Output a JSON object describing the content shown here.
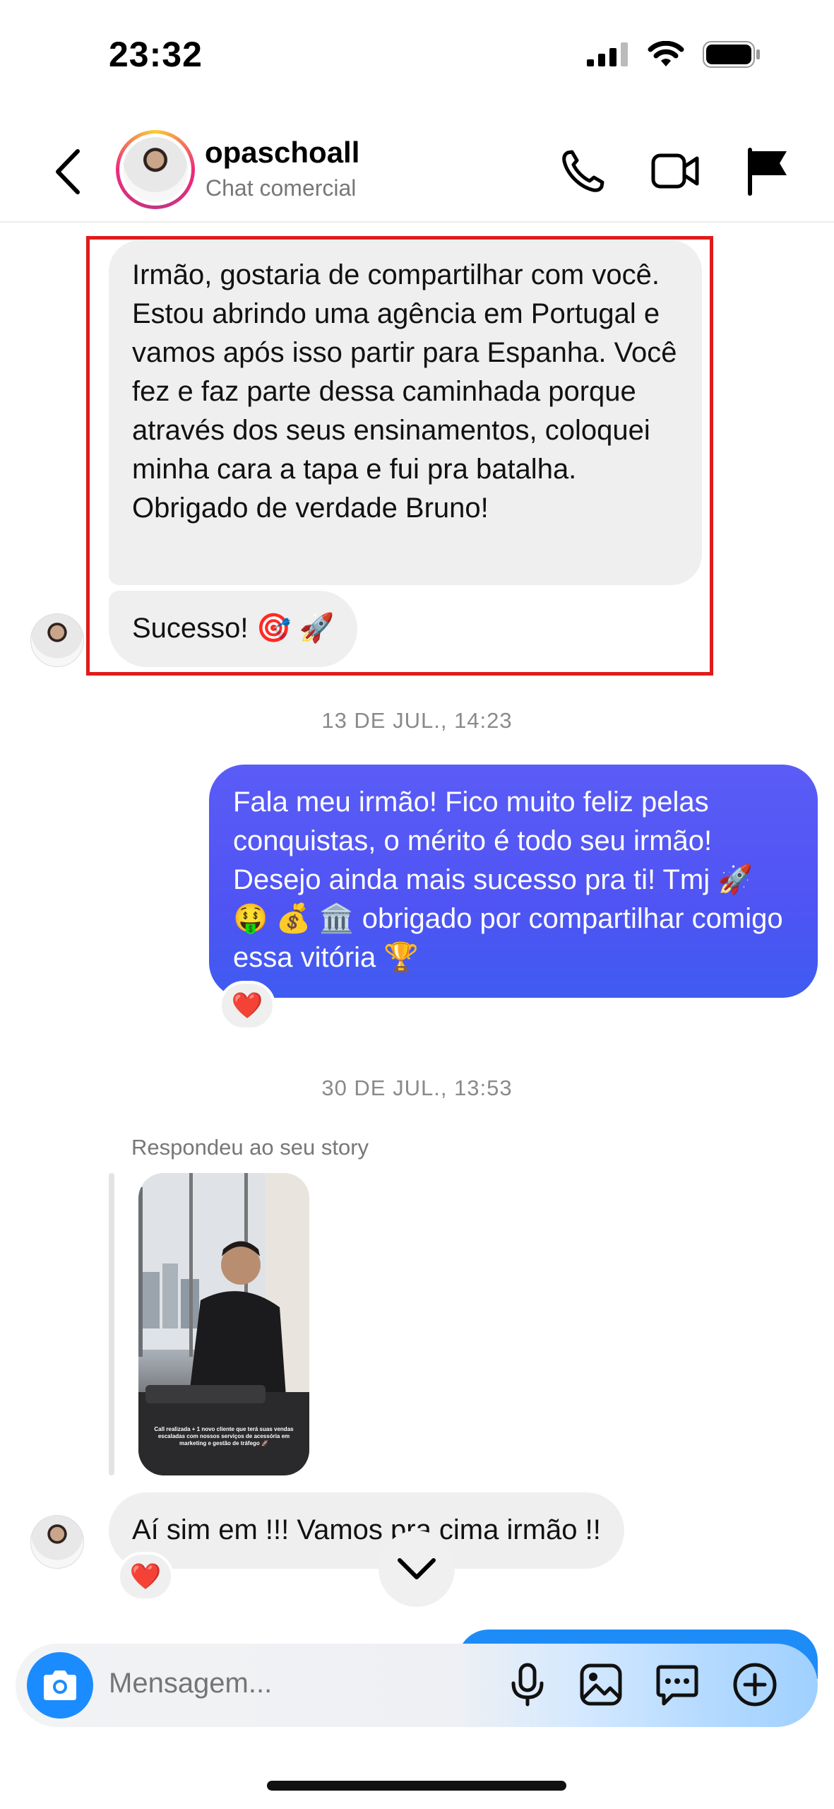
{
  "status": {
    "time": "23:32"
  },
  "header": {
    "name": "opaschoall",
    "subtitle": "Chat comercial"
  },
  "messages": {
    "m1": "Irmão, gostaria de compartilhar com você. Estou abrindo uma agência em Portugal e vamos após isso partir para Espanha. Você fez e faz parte dessa caminhada porque através dos seus ensinamentos, coloquei minha cara a tapa e fui pra batalha. Obrigado de verdade Bruno!",
    "m2": "Sucesso! 🎯 🚀",
    "ts1": "13 DE JUL., 14:23",
    "m3": "Fala meu irmão! Fico muito feliz pelas conquistas, o mérito é todo seu irmão! Desejo ainda mais sucesso pra ti! Tmj 🚀 🤑 💰 🏛️ obrigado por compartilhar comigo essa vitória 🏆",
    "m3_reaction": "❤️",
    "ts2": "30 DE JUL., 13:53",
    "story_label": "Respondeu ao seu story",
    "story_caption": "Call realizada + 1 novo cliente que terá suas vendas escaladas com nossos serviços de acessória em marketing e gestão de tráfego 🚀",
    "m4": "Aí sim em !!! Vamos pra cima irmão !!",
    "m4_reaction": "❤️"
  },
  "composer": {
    "placeholder": "Mensagem..."
  },
  "colors": {
    "outgoing": "#4f54f3",
    "highlight": "#e01b1b",
    "camera": "#1a8cff"
  },
  "icons": [
    "back-chevron-icon",
    "phone-icon",
    "video-icon",
    "flag-icon",
    "camera-icon",
    "microphone-icon",
    "gallery-icon",
    "sticker-icon",
    "plus-icon",
    "chevron-down-icon"
  ]
}
